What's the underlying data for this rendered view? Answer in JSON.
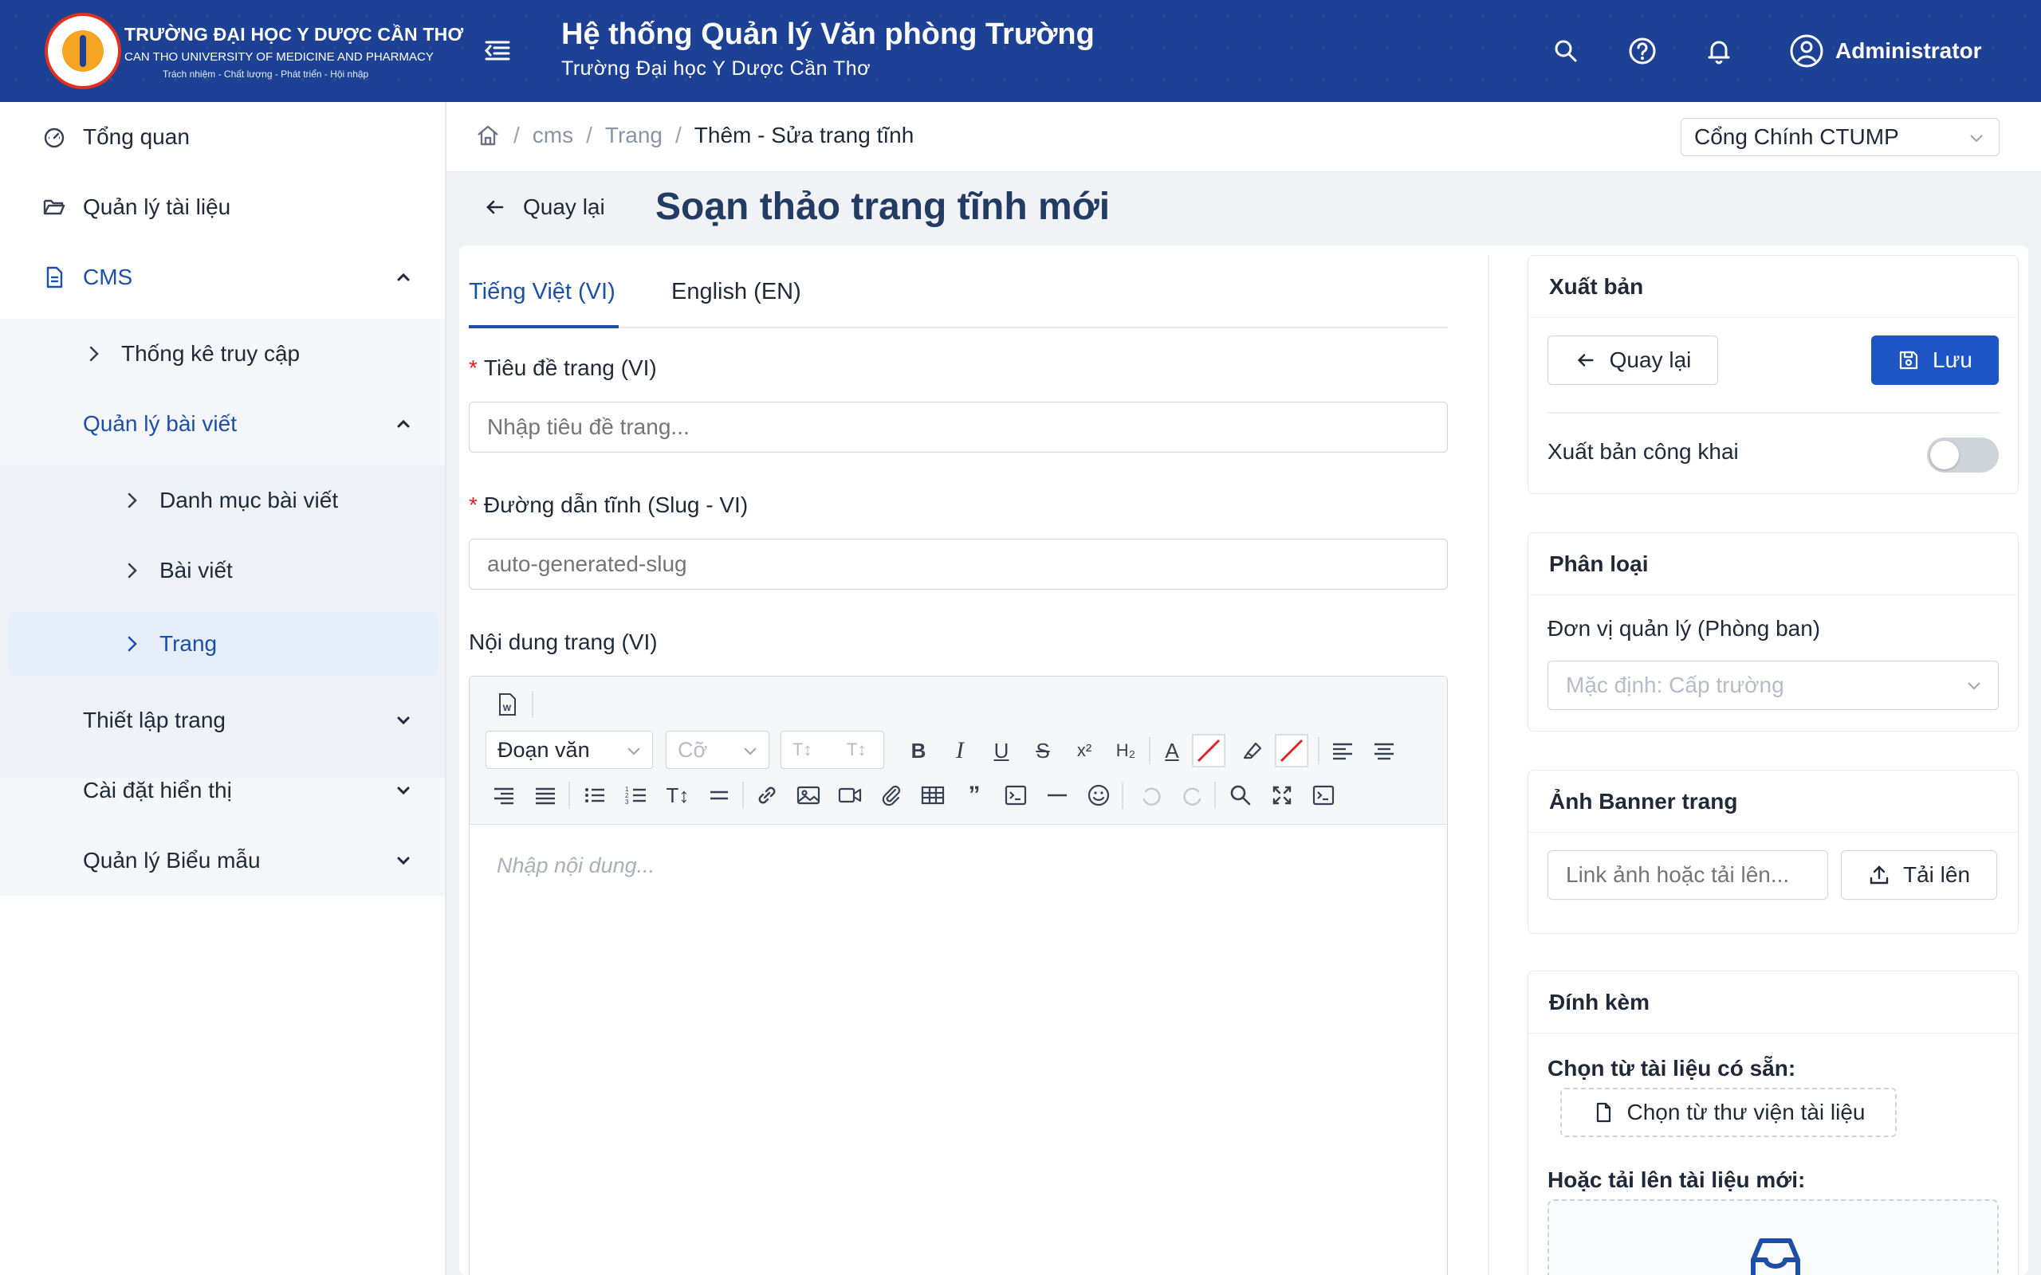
{
  "header": {
    "logo_title": "TRƯỜNG ĐẠI HỌC Y DƯỢC CẦN THƠ",
    "logo_subtitle": "CAN THO UNIVERSITY OF MEDICINE AND PHARMACY",
    "logo_motto": "Trách nhiệm - Chất lượng - Phát triển - Hội nhập",
    "app_title": "Hệ thống Quản lý Văn phòng Trường",
    "app_subtitle": "Trường Đại học Y Dược Cần Thơ",
    "user_name": "Administrator"
  },
  "sidebar": {
    "items": [
      {
        "label": "Tổng quan"
      },
      {
        "label": "Quản lý tài liệu"
      },
      {
        "label": "CMS"
      },
      {
        "label": "Thống kê truy cập"
      },
      {
        "label": "Quản lý bài viết"
      },
      {
        "label": "Danh mục bài viết"
      },
      {
        "label": "Bài viết"
      },
      {
        "label": "Trang"
      },
      {
        "label": "Thiết lập trang"
      },
      {
        "label": "Cài đặt hiển thị"
      },
      {
        "label": "Quản lý Biểu mẫu"
      }
    ]
  },
  "breadcrumb": {
    "items": [
      "cms",
      "Trang",
      "Thêm - Sửa trang tĩnh"
    ],
    "separator": "/"
  },
  "site_select": {
    "value": "Cổng Chính CTUMP"
  },
  "page": {
    "back_label": "Quay lại",
    "title": "Soạn thảo trang tĩnh mới"
  },
  "tabs": [
    {
      "label": "Tiếng Việt (VI)",
      "active": true
    },
    {
      "label": "English (EN)",
      "active": false
    }
  ],
  "form": {
    "title_label": "Tiêu đề trang (VI)",
    "title_placeholder": "Nhập tiêu đề trang...",
    "slug_label": "Đường dẫn tĩnh (Slug - VI)",
    "slug_placeholder": "auto-generated-slug",
    "content_label": "Nội dung trang (VI)",
    "content_placeholder": "Nhập nội dung...",
    "required_mark": "*"
  },
  "editor_toolbar": {
    "paragraph_select": "Đoạn văn",
    "size_select": "Cỡ",
    "line_height_a": "T↕",
    "line_height_b": "T↕"
  },
  "publish_panel": {
    "title": "Xuất bản",
    "back_label": "Quay lại",
    "save_label": "Lưu",
    "public_label": "Xuất bản công khai",
    "public_on": false
  },
  "classify_panel": {
    "title": "Phân loại",
    "unit_label": "Đơn vị quản lý (Phòng ban)",
    "unit_placeholder": "Mặc định: Cấp trường"
  },
  "banner_panel": {
    "title": "Ảnh Banner trang",
    "link_placeholder": "Link ảnh hoặc tải lên...",
    "upload_label": "Tải lên"
  },
  "attach_panel": {
    "title": "Đính kèm",
    "existing_label": "Chọn từ tài liệu có sẵn:",
    "library_button": "Chọn từ thư viện tài liệu",
    "new_label": "Hoặc tải lên tài liệu mới:"
  },
  "colors": {
    "brand": "#1d4194",
    "primary": "#1d55c4",
    "active_text": "#1d4ea8",
    "required": "#e02424"
  }
}
